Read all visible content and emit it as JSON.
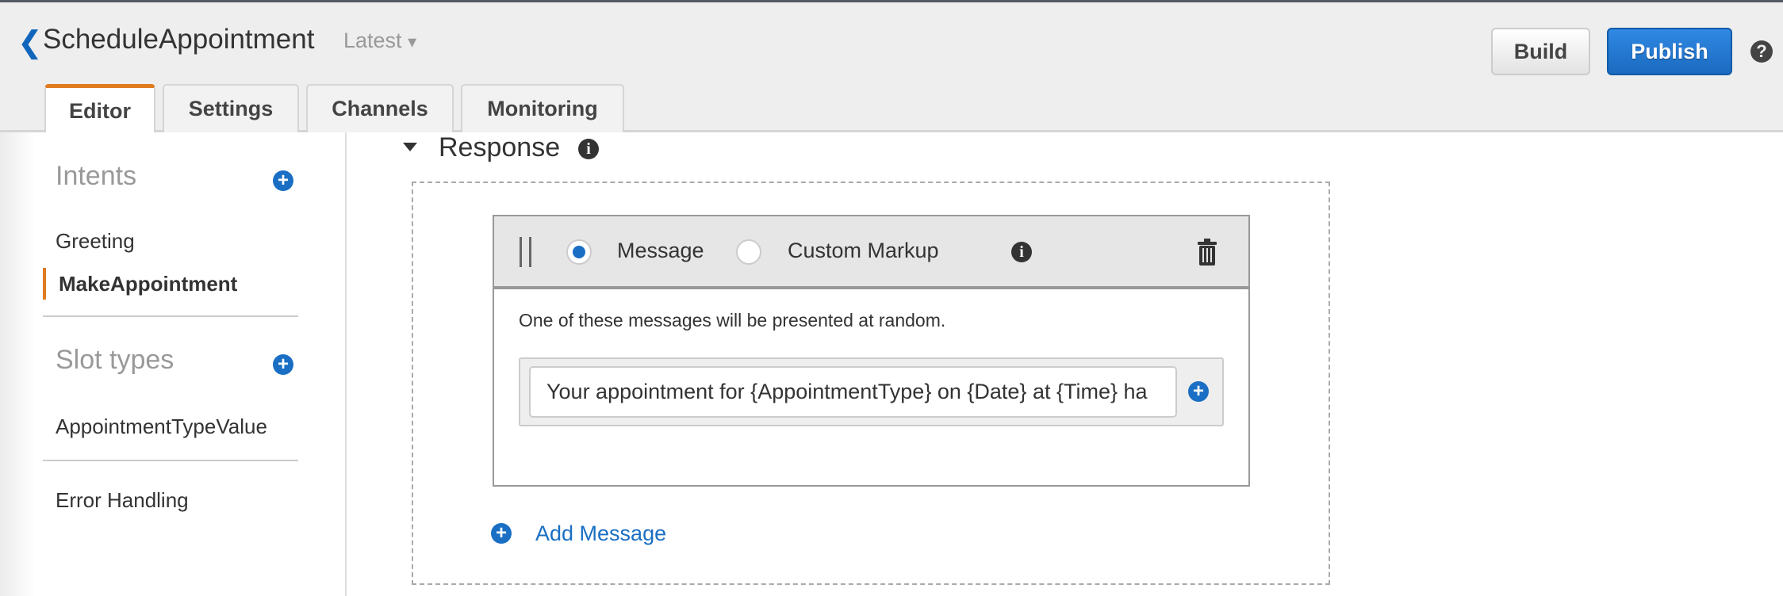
{
  "header": {
    "back_icon": "chevron-left-icon",
    "title": "ScheduleAppointment",
    "version": "Latest",
    "version_caret": "▾",
    "tabs": [
      {
        "label": "Editor",
        "active": true
      },
      {
        "label": "Settings",
        "active": false
      },
      {
        "label": "Channels",
        "active": false
      },
      {
        "label": "Monitoring",
        "active": false
      }
    ],
    "build_label": "Build",
    "publish_label": "Publish",
    "help_icon": "question-circle-icon"
  },
  "sidebar": {
    "intents_label": "Intents",
    "intents": [
      {
        "label": "Greeting",
        "selected": false
      },
      {
        "label": "MakeAppointment",
        "selected": true
      }
    ],
    "slot_types_label": "Slot types",
    "slot_types": [
      {
        "label": "AppointmentTypeValue"
      }
    ],
    "error_handling_label": "Error Handling"
  },
  "main": {
    "section_title": "Response",
    "card": {
      "format_options": [
        {
          "label": "Message",
          "selected": true
        },
        {
          "label": "Custom Markup",
          "selected": false
        }
      ],
      "hint": "One of these messages will be presented at random.",
      "message_value": "Your appointment for {AppointmentType} on {Date} at {Time} ha"
    },
    "add_message_label": "Add Message"
  },
  "colors": {
    "accent": "#1a6fc4",
    "active_tab": "#e07b1f",
    "publish": "#1f71c9"
  }
}
